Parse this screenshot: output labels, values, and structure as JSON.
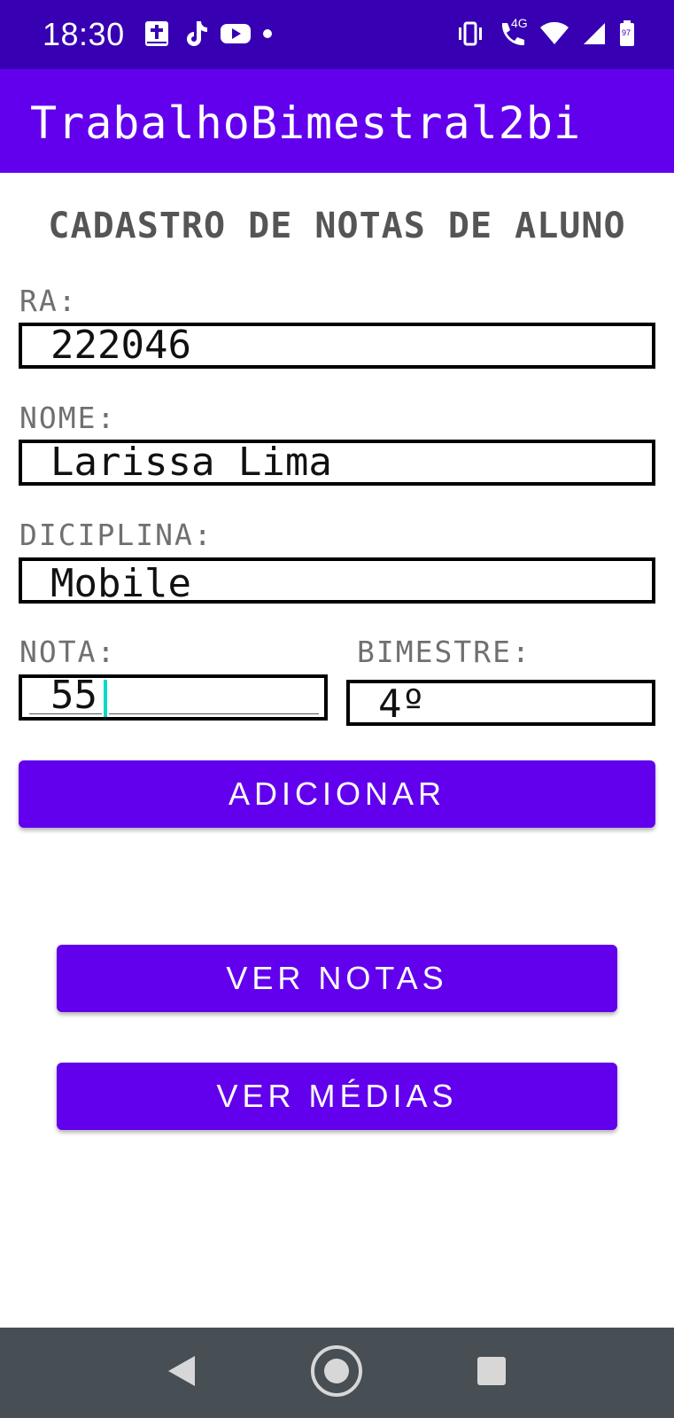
{
  "status_bar": {
    "time": "18:30",
    "left_icons": [
      "bible-app-icon",
      "tiktok-icon",
      "youtube-icon",
      "dot-icon"
    ],
    "right_icons": [
      "vibrate-icon",
      "volte-call-icon",
      "wifi-icon",
      "signal-icon",
      "battery-icon"
    ],
    "network_label": "4G",
    "battery_level": "97"
  },
  "app_bar": {
    "title": "TrabalhoBimestral2bi",
    "color": "#6200ee"
  },
  "form": {
    "title": "CADASTRO DE NOTAS DE ALUNO",
    "ra": {
      "label": "RA:",
      "value": "222046"
    },
    "nome": {
      "label": "NOME:",
      "value": "Larissa Lima"
    },
    "disciplina": {
      "label": "DICIPLINA:",
      "value": "Mobile"
    },
    "nota": {
      "label": "NOTA:",
      "value": "55"
    },
    "bimestre": {
      "label": "BIMESTRE:",
      "value": "4º"
    }
  },
  "buttons": {
    "adicionar": "ADICIONAR",
    "ver_notas": "VER NOTAS",
    "ver_medias": "VER MÉDIAS"
  },
  "nav_bar": {
    "icons": [
      "back-icon",
      "home-icon",
      "recents-icon"
    ]
  },
  "colors": {
    "status_bar": "#3700b3",
    "primary": "#6200ee",
    "cursor": "#03dac5",
    "nav_bar": "#474e54"
  }
}
